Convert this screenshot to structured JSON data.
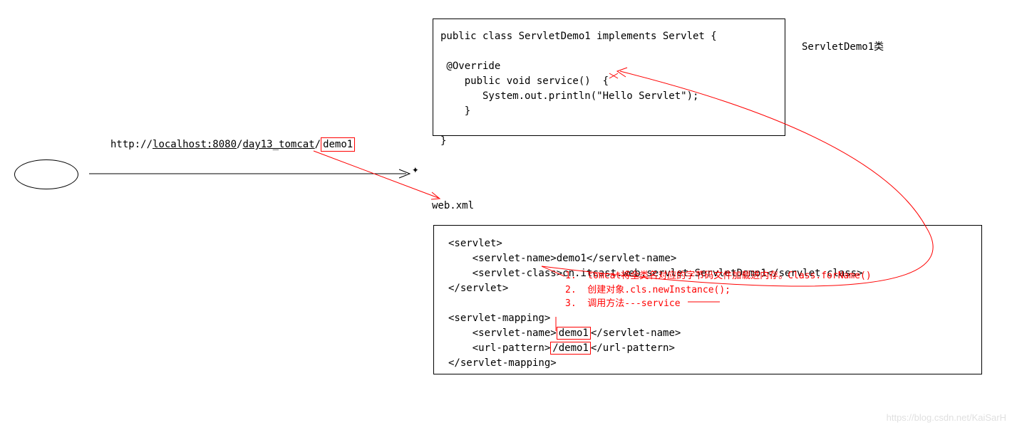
{
  "url": {
    "prefix": "http://",
    "host": "localhost:8080",
    "sep1": "/",
    "context": "day13_tomcat",
    "sep2": "/",
    "path": "demo1"
  },
  "codeTop": {
    "line1": "public class ServletDemo1 implements Servlet {",
    "line2": "",
    "line3": " @Override",
    "line4": "    public void service()  {",
    "line5": "       System.out.println(\"Hello Servlet\");",
    "line6": "    }",
    "line7": "",
    "line8": "}"
  },
  "classLabel": "ServletDemo1类",
  "webxmlLabel": "web.xml",
  "codeBottom": {
    "line1": "<servlet>",
    "line2": "    <servlet-name>demo1</servlet-name>",
    "line3_prefix": "    <servlet-class>",
    "line3_content": "cn.itcast.web.servlet.ServletDemo1",
    "line3_suffix": "</servlet-class>",
    "line4": "</servlet>",
    "line5": "",
    "line6": "<servlet-mapping>",
    "line7_prefix": "    <servlet-name>",
    "line7_content": "demo1",
    "line7_suffix": "</servlet-name>",
    "line8_prefix": "    <url-pattern>",
    "line8_content": "/demo1",
    "line8_suffix": "</url-pattern>",
    "line9": "</servlet-mapping>"
  },
  "redComment": {
    "line1": "1.  tomcat将全类名对应的字节码文件加载进内存。Class.forName()",
    "line2": "2.  创建对象.cls.newInstance();",
    "line3": "3.  调用方法---service"
  },
  "watermark": "https://blog.csdn.net/KaiSarH"
}
